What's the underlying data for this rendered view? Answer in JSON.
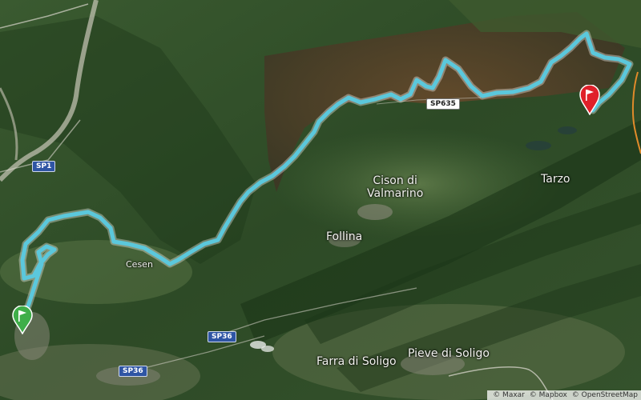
{
  "map": {
    "places": {
      "cison_line1": "Cison di",
      "cison_line2": "Valmarino",
      "tarzo": "Tarzo",
      "follina": "Follina",
      "cesen": "Cesen",
      "farra": "Farra di Soligo",
      "pieve": "Pieve di Soligo"
    },
    "roads": {
      "sp635": "SP635",
      "sp1": "SP1",
      "sp36_a": "SP36",
      "sp36_b": "SP36"
    },
    "route_color": "#5bc8dc",
    "start_marker_color": "#3fae49",
    "end_marker_color": "#e0202a",
    "attribution": {
      "maxar": "© Maxar",
      "mapbox": "© Mapbox",
      "osm": "© OpenStreetMap"
    }
  }
}
